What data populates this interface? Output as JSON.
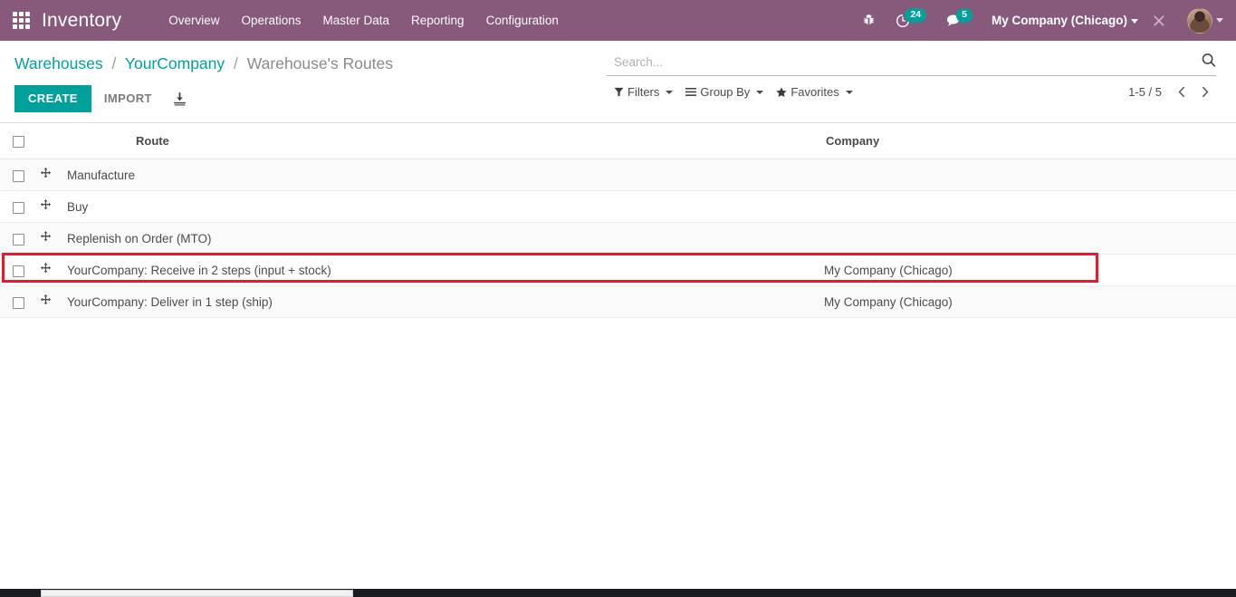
{
  "navbar": {
    "apps_icon": "apps-grid-icon",
    "brand": "Inventory",
    "menu": [
      {
        "label": "Overview"
      },
      {
        "label": "Operations"
      },
      {
        "label": "Master Data"
      },
      {
        "label": "Reporting"
      },
      {
        "label": "Configuration"
      }
    ],
    "debug_icon": "bug-icon",
    "activities": {
      "icon": "clock-activity-icon",
      "count": "24"
    },
    "messages": {
      "icon": "chat-bubble-icon",
      "count": "5"
    },
    "company_switcher": {
      "label": "My Company (Chicago)"
    },
    "tools_icon": "tools-wrench-screwdriver-icon",
    "avatar": {
      "icon": "user-avatar"
    },
    "colors": {
      "background": "#875A7B",
      "badge": "#00A09D",
      "text": "#FFFFFF"
    }
  },
  "control_panel": {
    "breadcrumb": {
      "items": [
        {
          "label": "Warehouses",
          "link": true
        },
        {
          "label": "YourCompany",
          "link": true
        },
        {
          "label": "Warehouse's Routes",
          "link": false
        }
      ],
      "separator": "/"
    },
    "buttons": {
      "create_label": "CREATE",
      "import_label": "IMPORT",
      "export_icon": "download-export-icon"
    },
    "search": {
      "placeholder": "Search...",
      "value": "",
      "icon": "search-icon"
    },
    "filters": {
      "label": "Filters",
      "icon": "filter-funnel-icon"
    },
    "group_by": {
      "label": "Group By",
      "icon": "bars-icon"
    },
    "favorites": {
      "label": "Favorites",
      "icon": "star-icon"
    },
    "pager": {
      "value": "1-5 / 5",
      "previous_icon": "chevron-left-icon",
      "next_icon": "chevron-right-icon"
    }
  },
  "list": {
    "columns": [
      {
        "key": "route",
        "label": "Route"
      },
      {
        "key": "company",
        "label": "Company"
      }
    ],
    "rows": [
      {
        "route": "Manufacture",
        "company": ""
      },
      {
        "route": "Buy",
        "company": ""
      },
      {
        "route": "Replenish on Order (MTO)",
        "company": ""
      },
      {
        "route": "YourCompany: Receive in 2 steps (input + stock)",
        "company": "My Company (Chicago)"
      },
      {
        "route": "YourCompany: Deliver in 1 step (ship)",
        "company": "My Company (Chicago)"
      }
    ],
    "highlighted_row_index": 3,
    "highlight_color": "#E8192C"
  },
  "colors": {
    "brand_purple": "#875A7B",
    "accent_teal": "#00A09D",
    "highlight_red": "#E8192C"
  }
}
